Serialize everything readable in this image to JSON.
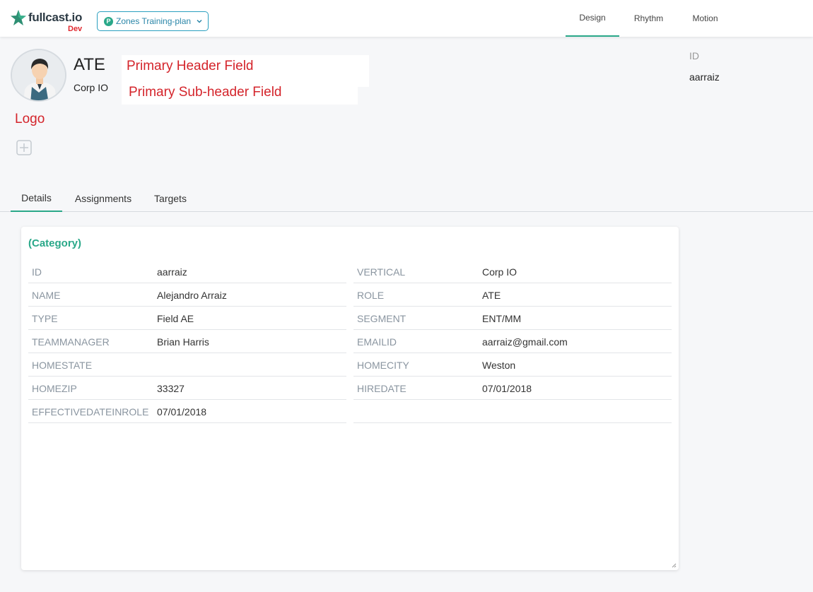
{
  "brand": {
    "name": "fullcast.io",
    "env": "Dev"
  },
  "plan_selector": {
    "badge": "P",
    "label": "Zones Training-plan"
  },
  "nav": {
    "tabs": [
      "Design",
      "Rhythm",
      "Motion"
    ],
    "active": "Design"
  },
  "header": {
    "title": "ATE",
    "subtitle": "Corp IO",
    "annotation_primary_header": "Primary Header Field",
    "annotation_primary_subheader": "Primary Sub-header Field",
    "annotation_logo": "Logo",
    "id_label": "ID",
    "id_value": "aarraiz"
  },
  "tabs": {
    "items": [
      "Details",
      "Assignments",
      "Targets"
    ],
    "active": "Details"
  },
  "details": {
    "category": "(Category)",
    "left_fields": [
      {
        "label": "ID",
        "value": "aarraiz"
      },
      {
        "label": "NAME",
        "value": "Alejandro Arraiz"
      },
      {
        "label": "TYPE",
        "value": "Field AE"
      },
      {
        "label": "TEAMMANAGER",
        "value": "Brian Harris"
      },
      {
        "label": "HOMESTATE",
        "value": ""
      },
      {
        "label": "HOMEZIP",
        "value": "33327"
      },
      {
        "label": "EFFECTIVEDATEINROLE",
        "value": "07/01/2018"
      }
    ],
    "right_fields": [
      {
        "label": "VERTICAL",
        "value": "Corp IO"
      },
      {
        "label": "ROLE",
        "value": "ATE"
      },
      {
        "label": "SEGMENT",
        "value": "ENT/MM"
      },
      {
        "label": "EMAILID",
        "value": "aarraiz@gmail.com"
      },
      {
        "label": "HOMECITY",
        "value": "Weston"
      },
      {
        "label": "HIREDATE",
        "value": "07/01/2018"
      }
    ]
  },
  "colors": {
    "accent": "#2aa889",
    "plan_border": "#2a9fbf",
    "annotation": "#d4242b",
    "env": "#e0282e"
  }
}
